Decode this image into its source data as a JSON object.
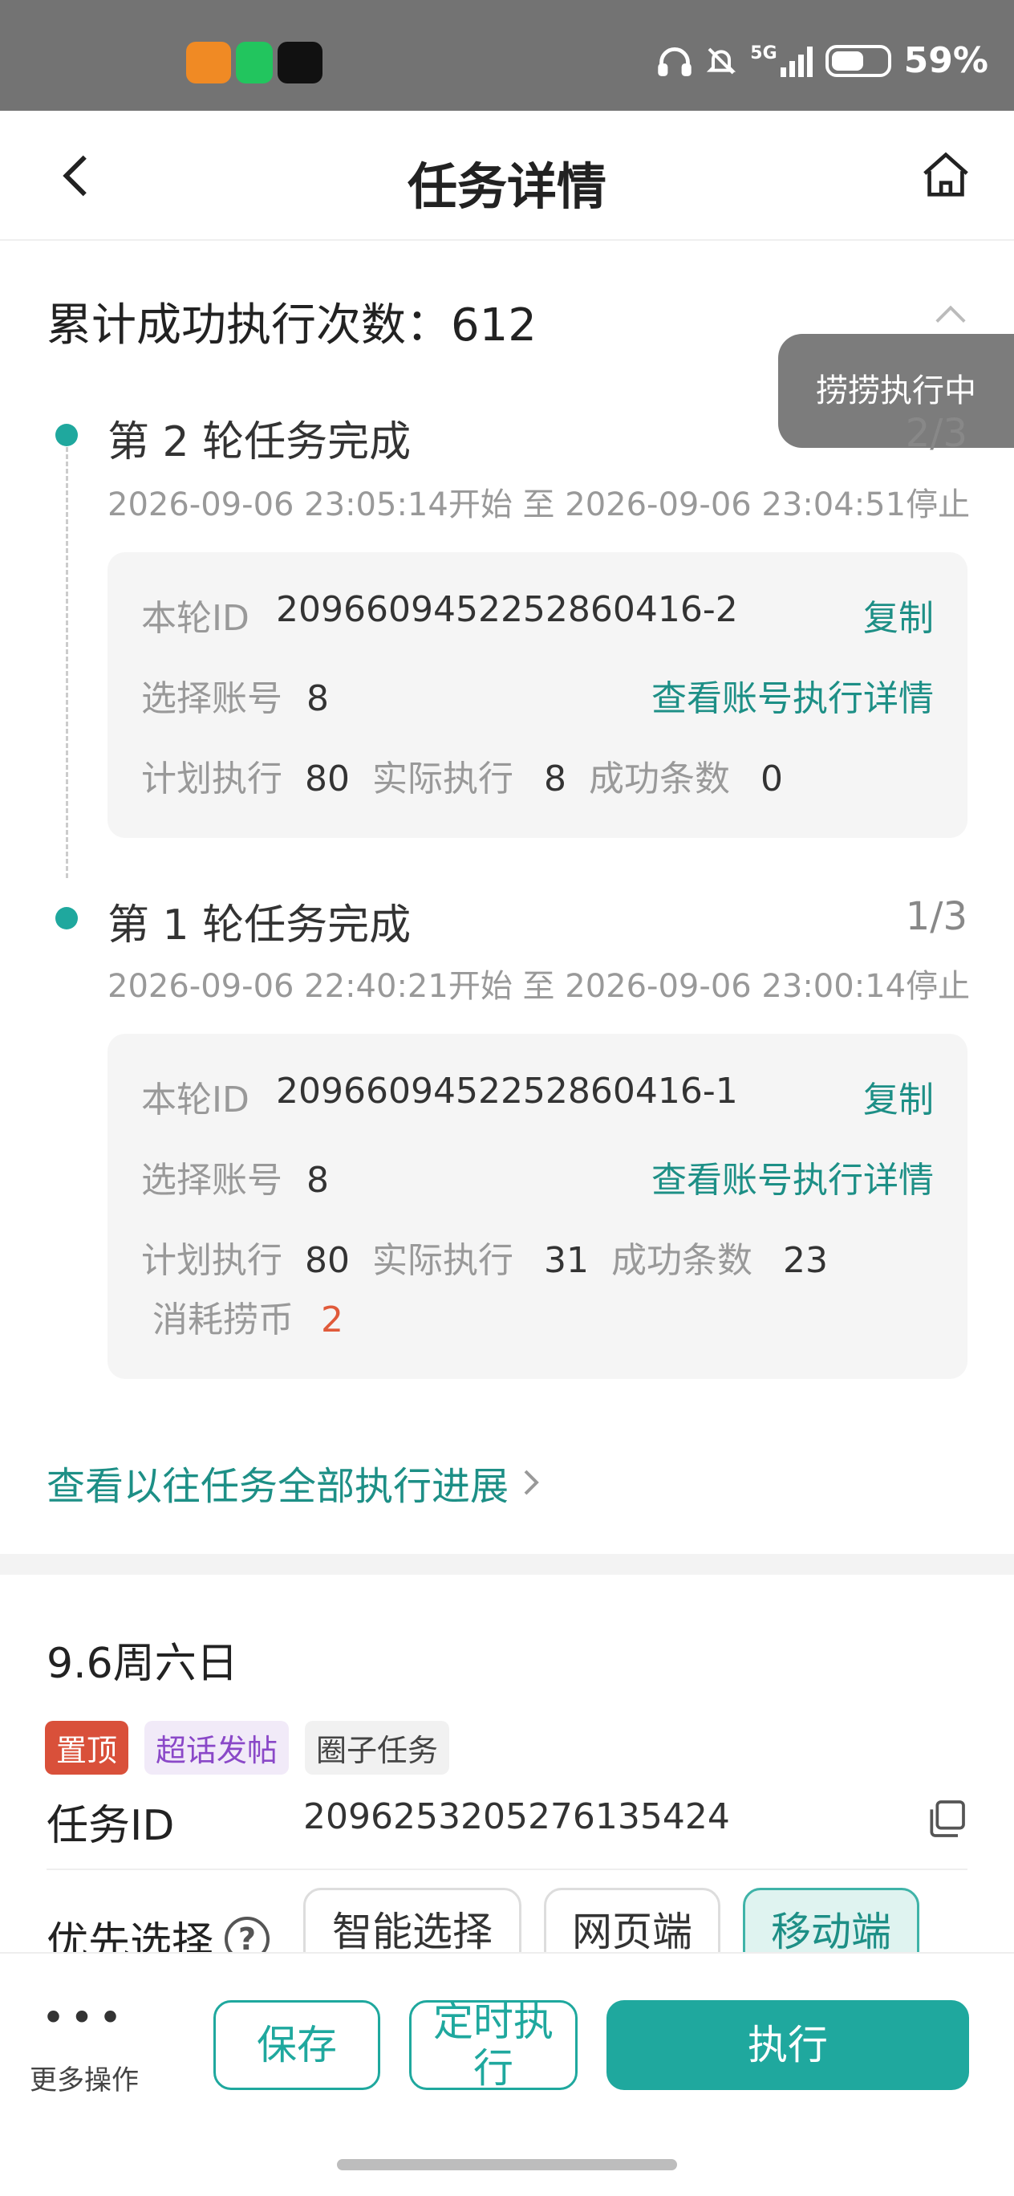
{
  "status_bar": {
    "network": "5G",
    "battery": "59%",
    "battery_level": 0.59
  },
  "header": {
    "title": "任务详情"
  },
  "summary": {
    "label": "累计成功执行次数：",
    "count": "612"
  },
  "toast": {
    "text": "捞捞执行中"
  },
  "rounds": [
    {
      "title": "第 2 轮任务完成",
      "progress": "2/3",
      "time": "2026-09-06 23:05:14开始 至 2026-09-06 23:04:51停止",
      "id_label": "本轮ID",
      "id_value": "209660945225286041​6-2",
      "copy_label": "复制",
      "account_label": "选择账号",
      "account_value": "8",
      "account_link": "查看账号执行详情",
      "plan_label": "计划执行",
      "plan_value": "80",
      "actual_label": "实际执行",
      "actual_value": "8",
      "success_label": "成功条数",
      "success_value": "0"
    },
    {
      "title": "第 1 轮任务完成",
      "progress": "1/3",
      "time": "2026-09-06 22:40:21开始 至 2026-09-06 23:00:14停止",
      "id_label": "本轮ID",
      "id_value": "2096609452252860416-1",
      "copy_label": "复制",
      "account_label": "选择账号",
      "account_value": "8",
      "account_link": "查看账号执行详情",
      "plan_label": "计划执行",
      "plan_value": "80",
      "actual_label": "实际执行",
      "actual_value": "31",
      "success_label": "成功条数",
      "success_value": "23",
      "cost_label": "消耗捞币",
      "cost_value": "2"
    }
  ],
  "history_link": "查看以往任务全部执行进展",
  "task": {
    "date_title": "9.6周六日",
    "tags": [
      "置顶",
      "超话发帖",
      "圈子任务"
    ],
    "id_label": "任务ID",
    "id_value": "2096253205276135424",
    "priority_label": "优先选择",
    "options": [
      "智能选择",
      "网页端",
      "移动端"
    ],
    "selected_option": "移动端"
  },
  "bottom_bar": {
    "more_label": "更多操作",
    "save_label": "保存",
    "schedule_label": "定时执行",
    "execute_label": "执行"
  },
  "colors": {
    "accent": "#1fa89e",
    "link": "#1d8f86",
    "danger": "#d9503a",
    "topic_tag": "#8a48c8"
  }
}
